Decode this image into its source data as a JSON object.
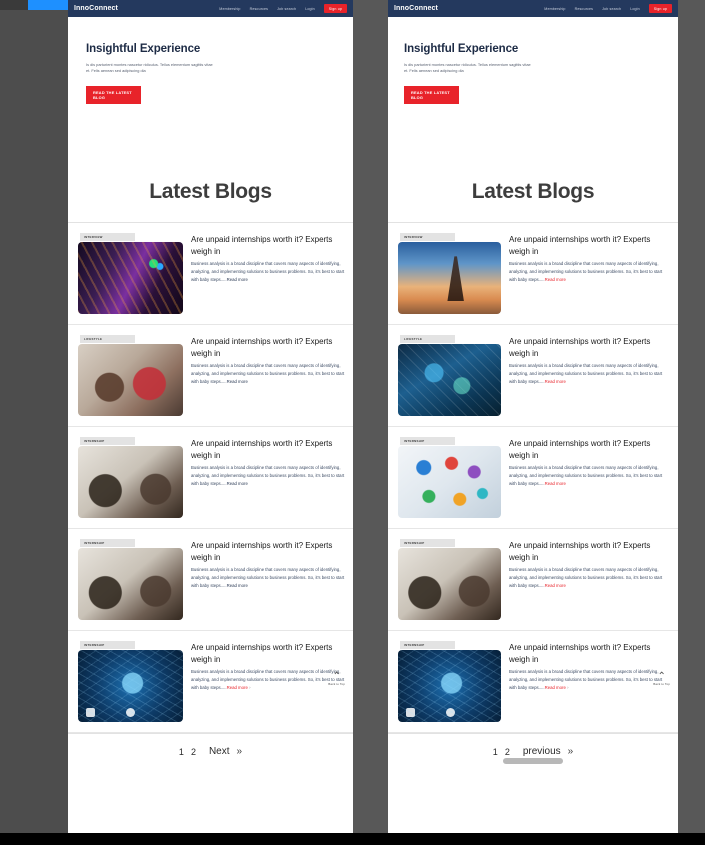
{
  "site": {
    "logo": "InnoConnect",
    "nav_links": [
      "Membership",
      "Resources",
      "Job search",
      "Login"
    ],
    "signup_label": "Sign up"
  },
  "hero": {
    "title": "Insightful Experience",
    "body": "Is dis parturient montes nascetur ridiculus. Tellus elementum sagittis vitae et. Felis aenean sed adipiscing dia",
    "cta": "READ THE LATEST BLOG"
  },
  "section": {
    "heading": "Latest Blogs"
  },
  "card_common": {
    "title": "Are unpaid internships worth it?  Experts weigh in",
    "body": "Business analysis is a broad discipline that covers many aspects of identifying, analyzing, and implementing solutions to business problems. So, it's best to start with baby steps.....",
    "readmore": "Read more",
    "chevron": "›"
  },
  "left_panel": {
    "cards": [
      {
        "tag": "INTERVIEW",
        "thumb": "circuit-board-photo"
      },
      {
        "tag": "LIFESTYLE",
        "thumb": "meeting-people-photo"
      },
      {
        "tag": "INTERNSHIP",
        "thumb": "office-interview-photo"
      },
      {
        "tag": "INTERNSHIP",
        "thumb": "woman-laptop-photo"
      },
      {
        "tag": "INTERNSHIP",
        "thumb": "brain-network-photo"
      }
    ],
    "pagination": {
      "pages": [
        "1",
        "2"
      ],
      "word": "Next",
      "double": "»"
    }
  },
  "right_panel": {
    "cards": [
      {
        "tag": "INTERVIEW",
        "thumb": "eiffel-tower-photo"
      },
      {
        "tag": "LIFESTYLE",
        "thumb": "tech-globe-photo"
      },
      {
        "tag": "INTERNSHIP",
        "thumb": "app-icons-photo"
      },
      {
        "tag": "INTERNSHIP",
        "thumb": "woman-laptop-photo"
      },
      {
        "tag": "INTERNSHIP",
        "thumb": "brain-network-photo"
      }
    ],
    "pagination": {
      "pages": [
        "1",
        "2"
      ],
      "word": "previous",
      "double": "»"
    }
  },
  "back_to_top": {
    "arrow": "⌃",
    "label": "Back to Top"
  },
  "colors": {
    "nav_bg": "#24395e",
    "accent_red": "#e8232a",
    "page_bg": "#4d4d4d",
    "heading": "#3d3d3d"
  }
}
